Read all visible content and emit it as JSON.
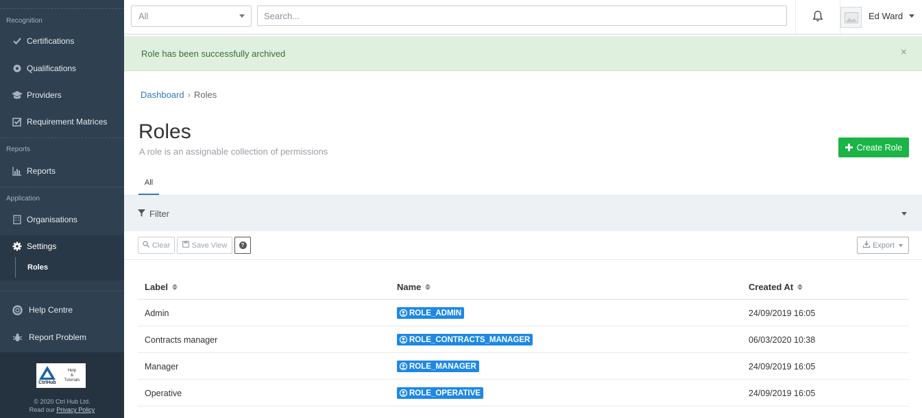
{
  "sidebar": {
    "sections": [
      {
        "label": "Recognition"
      },
      {
        "label": "Reports"
      },
      {
        "label": "Application"
      }
    ],
    "items": [
      {
        "label": "Certifications",
        "icon": "check-icon"
      },
      {
        "label": "Qualifications",
        "icon": "badge-icon"
      },
      {
        "label": "Providers",
        "icon": "graduation-cap-icon"
      },
      {
        "label": "Requirement Matrices",
        "icon": "checkbox-icon"
      },
      {
        "label": "Reports",
        "icon": "bar-chart-icon"
      },
      {
        "label": "Organisations",
        "icon": "building-icon"
      },
      {
        "label": "Settings",
        "icon": "gear-icon"
      }
    ],
    "sub_item": "Roles",
    "bottom_items": [
      {
        "label": "Help Centre",
        "icon": "lifebuoy-icon"
      },
      {
        "label": "Report Problem",
        "icon": "bug-icon"
      }
    ],
    "logo": {
      "brand": "CtrlHub",
      "line1": "Help",
      "line2": "&",
      "line3": "Tutorials"
    },
    "copyright": "© 2020 Ctrl Hub Ltd.",
    "privacy_prefix": "Read our",
    "privacy_link": "Privacy Policy"
  },
  "topbar": {
    "scope_select": "All",
    "search_placeholder": "Search...",
    "user_name": "Ed Ward"
  },
  "alert": {
    "message": "Role has been successfully archived",
    "close": "×"
  },
  "breadcrumb": {
    "home": "Dashboard",
    "separator": "›",
    "current": "Roles"
  },
  "page": {
    "title": "Roles",
    "subtitle": "A role is an assignable collection of permissions",
    "create_button": "Create Role",
    "tab_all": "All"
  },
  "filter": {
    "label": "Filter"
  },
  "toolbar": {
    "clear": "Clear",
    "save_view": "Save View",
    "help": "?",
    "export": "Export"
  },
  "table": {
    "columns": [
      "Label",
      "Name",
      "Created At"
    ],
    "rows": [
      {
        "label": "Admin",
        "name": "ROLE_ADMIN",
        "created": "24/09/2019 16:05"
      },
      {
        "label": "Contracts manager",
        "name": "ROLE_CONTRACTS_MANAGER",
        "created": "06/03/2020 10:38"
      },
      {
        "label": "Manager",
        "name": "ROLE_MANAGER",
        "created": "24/09/2019 16:05"
      },
      {
        "label": "Operative",
        "name": "ROLE_OPERATIVE",
        "created": "24/09/2019 16:05"
      }
    ]
  },
  "colors": {
    "sidebar_bg": "#2f4050",
    "accent": "#337ab7",
    "success": "#1ab447",
    "badge": "#1e88e5",
    "alert_bg": "#dff0df"
  }
}
